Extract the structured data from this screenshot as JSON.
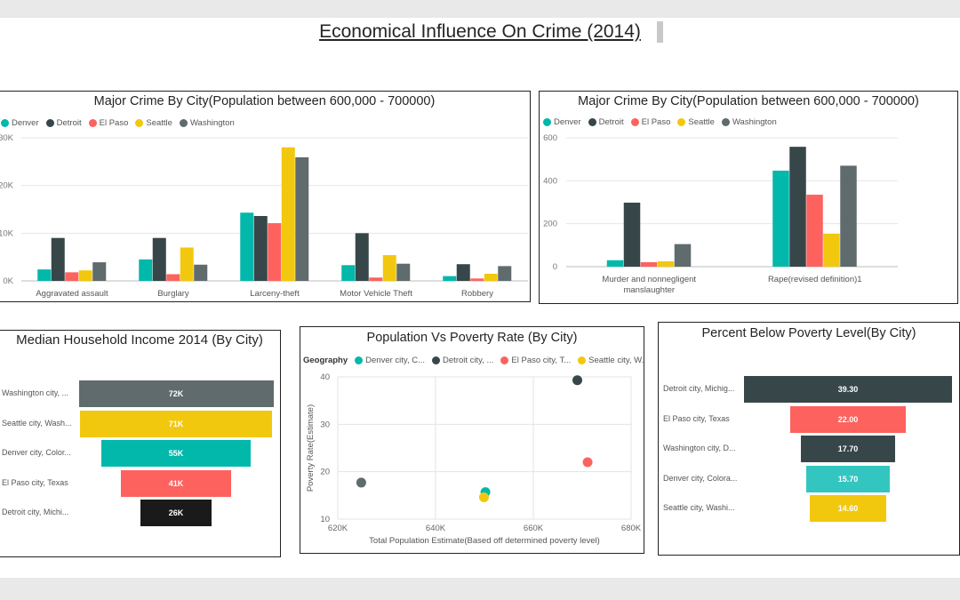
{
  "report": {
    "title": "Economical Influence On Crime (2014)"
  },
  "colors": {
    "Denver": "#01B8AA",
    "Detroit": "#374649",
    "El Paso": "#FD625E",
    "Seattle": "#F2C80F",
    "Washington": "#5F6B6D"
  },
  "chart_data": [
    {
      "id": "major-crime-1",
      "type": "bar",
      "title": "Major Crime By City(Population between 600,000 - 700000)",
      "categories": [
        "Aggravated assault",
        "Burglary",
        "Larceny-theft",
        "Motor Vehicle Theft",
        "Robbery"
      ],
      "series": [
        {
          "name": "Denver",
          "values": [
            2400,
            4500,
            14300,
            3300,
            1000
          ]
        },
        {
          "name": "Detroit",
          "values": [
            9000,
            9000,
            13600,
            10000,
            3500
          ]
        },
        {
          "name": "El Paso",
          "values": [
            1800,
            1400,
            12100,
            700,
            500
          ]
        },
        {
          "name": "Seattle",
          "values": [
            2200,
            7000,
            28000,
            5400,
            1500
          ]
        },
        {
          "name": "Washington",
          "values": [
            3900,
            3400,
            25900,
            3600,
            3100
          ]
        }
      ],
      "ylim": [
        0,
        30000
      ],
      "yticks": [
        0,
        10000,
        20000,
        30000
      ],
      "ytick_labels": [
        "0K",
        "10K",
        "20K",
        "30K"
      ],
      "legend": "top-left",
      "grid": true
    },
    {
      "id": "major-crime-2",
      "type": "bar",
      "title": "Major Crime By City(Population between 600,000 - 700000)",
      "categories": [
        "Murder and nonnegligent manslaughter",
        "Rape(revised definition)1"
      ],
      "category_lines": [
        [
          "Murder and nonnegligent",
          "manslaughter"
        ],
        [
          "Rape(revised definition)1"
        ]
      ],
      "series": [
        {
          "name": "Denver",
          "values": [
            30,
            447
          ]
        },
        {
          "name": "Detroit",
          "values": [
            298,
            558
          ]
        },
        {
          "name": "El Paso",
          "values": [
            21,
            335
          ]
        },
        {
          "name": "Seattle",
          "values": [
            25,
            154
          ]
        },
        {
          "name": "Washington",
          "values": [
            105,
            470
          ]
        }
      ],
      "ylim": [
        0,
        600
      ],
      "yticks": [
        0,
        200,
        400,
        600
      ],
      "ytick_labels": [
        "0",
        "200",
        "400",
        "600"
      ],
      "legend": "top-left",
      "grid": true
    },
    {
      "id": "median-income",
      "type": "funnel",
      "title": "Median Household Income 2014 (By City)",
      "categories": [
        "Washington city, ...",
        "Seattle city, Wash...",
        "Denver city, Color...",
        "El Paso city, Texas",
        "Detroit city, Michi..."
      ],
      "values": [
        72,
        71,
        55,
        41,
        26
      ],
      "value_labels": [
        "72K",
        "71K",
        "55K",
        "41K",
        "26K"
      ],
      "colors": [
        "#5F6B6D",
        "#F2C80F",
        "#01B8AA",
        "#FD625E",
        "#1a1a1a"
      ]
    },
    {
      "id": "population-poverty",
      "type": "scatter",
      "title": "Population Vs Poverty Rate (By City)",
      "legend_title": "Geography",
      "legend_entries": [
        {
          "label": "Denver city, C...",
          "color": "#01B8AA"
        },
        {
          "label": "Detroit city, ...",
          "color": "#374649"
        },
        {
          "label": "El Paso city, T...",
          "color": "#FD625E"
        },
        {
          "label": "Seattle city, W...",
          "color": "#F2C80F"
        }
      ],
      "points": [
        {
          "city": "Washington",
          "x": 624800,
          "y": 17.7,
          "color": "#5F6B6D"
        },
        {
          "city": "Denver",
          "x": 650200,
          "y": 15.7,
          "color": "#01B8AA"
        },
        {
          "city": "Seattle",
          "x": 649900,
          "y": 14.6,
          "color": "#F2C80F"
        },
        {
          "city": "Detroit",
          "x": 669000,
          "y": 39.3,
          "color": "#374649"
        },
        {
          "city": "El Paso",
          "x": 671100,
          "y": 22.0,
          "color": "#FD625E"
        }
      ],
      "xlabel": "Total Population Estimate(Based off determined poverty level)",
      "ylabel": "Poverty Rate(Estimate)",
      "xlim": [
        620000,
        680000
      ],
      "ylim": [
        10,
        40
      ],
      "xticks": [
        620000,
        640000,
        660000,
        680000
      ],
      "xtick_labels": [
        "620K",
        "640K",
        "660K",
        "680K"
      ],
      "yticks": [
        10,
        20,
        30,
        40
      ],
      "ytick_labels": [
        "10",
        "20",
        "30",
        "40"
      ],
      "grid": true
    },
    {
      "id": "poverty-level",
      "type": "funnel",
      "title": "Percent Below Poverty Level(By City)",
      "categories": [
        "Detroit city, Michig...",
        "El Paso city, Texas",
        "Washington city, D...",
        "Denver city, Colora...",
        "Seattle city, Washi..."
      ],
      "values": [
        39.3,
        22.0,
        17.7,
        15.7,
        14.6
      ],
      "value_labels": [
        "39.30",
        "22.00",
        "17.70",
        "15.70",
        "14.60"
      ],
      "colors": [
        "#374649",
        "#FD625E",
        "#374649",
        "#33C6C0",
        "#F2C80F"
      ]
    }
  ]
}
